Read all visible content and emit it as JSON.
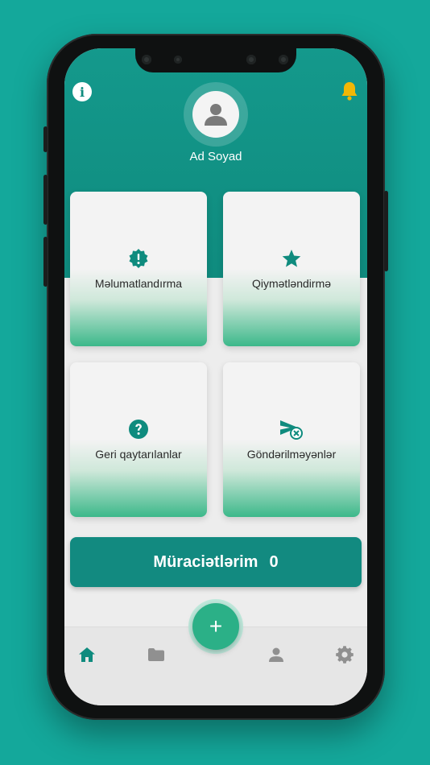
{
  "profile": {
    "name": "Ad Soyad"
  },
  "cards": [
    {
      "label": "Məlumatlandırma",
      "icon": "alert-badge-icon"
    },
    {
      "label": "Qiymətləndirmə",
      "icon": "star-icon"
    },
    {
      "label": "Geri qaytarılanlar",
      "icon": "question-icon"
    },
    {
      "label": "Göndərilməyənlər",
      "icon": "send-cancel-icon"
    }
  ],
  "applications": {
    "label": "Müraciətlərim",
    "count": "0"
  },
  "fab": {
    "symbol": "+"
  },
  "nav": [
    "home-icon",
    "folder-icon",
    "person-icon",
    "gear-icon"
  ],
  "colors": {
    "primary": "#0f8b7e",
    "accent": "#2bb087",
    "bell": "#f2b705",
    "background": "#14a89b"
  }
}
